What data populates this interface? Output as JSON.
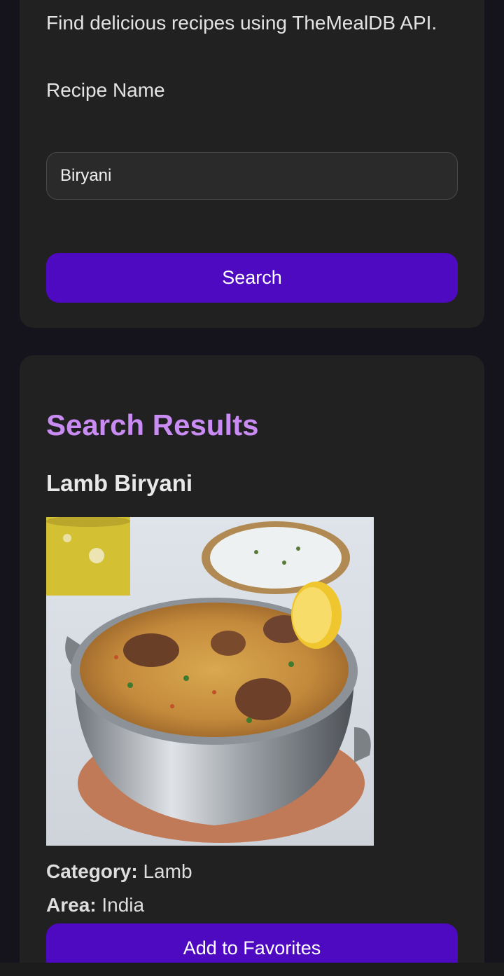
{
  "search_card": {
    "description": "Find delicious recipes using TheMealDB API.",
    "field_label": "Recipe Name",
    "input_value": "Biryani",
    "search_button": "Search"
  },
  "results": {
    "heading": "Search Results",
    "meals": [
      {
        "name": "Lamb Biryani",
        "image": "lamb-biryani-photo",
        "category_label": "Category:",
        "category": "Lamb",
        "area_label": "Area:",
        "area": "India",
        "favorite_button": "Add to Favorites"
      }
    ]
  },
  "colors": {
    "page_background": "#15141c",
    "card_background": "#212121",
    "accent_button": "#4e0ac0",
    "heading_purple": "#c98cf2"
  }
}
